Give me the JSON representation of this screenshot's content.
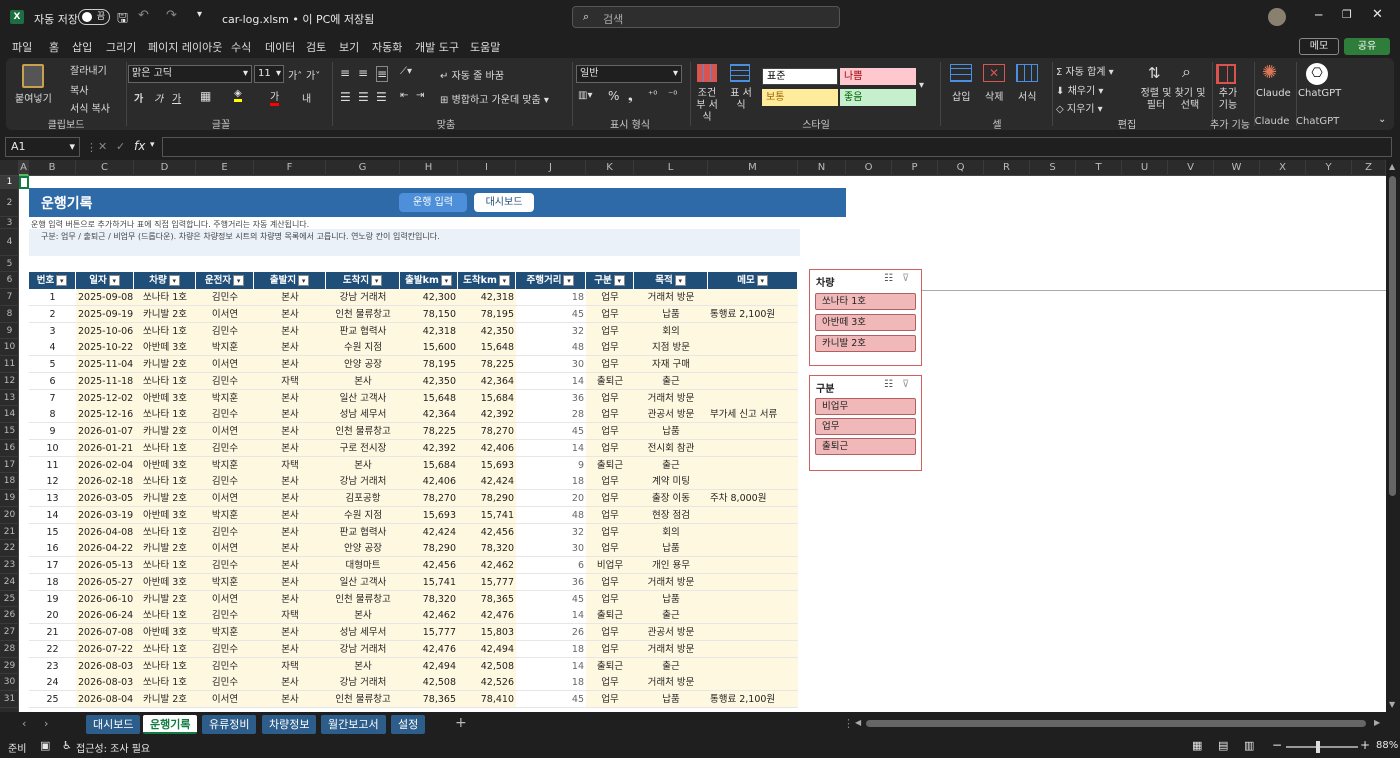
{
  "titlebar": {
    "autosave_label": "자동 저장",
    "toggle_label": "끔",
    "filename": "car-log.xlsm • 이 PC에 저장됨",
    "search_placeholder": "검색"
  },
  "menu": [
    "파일",
    "홈",
    "삽입",
    "그리기",
    "페이지 레이아웃",
    "수식",
    "데이터",
    "검토",
    "보기",
    "자동화",
    "개발 도구",
    "도움말"
  ],
  "menu_right": {
    "memo": "메모",
    "share": "공유"
  },
  "ribbon": {
    "clipboard": {
      "paste": "붙여넣기",
      "cut": "잘라내기",
      "copy": "복사",
      "format_painter": "서식 복사",
      "group": "클립보드"
    },
    "font": {
      "name": "맑은 고딕",
      "size": "11",
      "group": "글꼴"
    },
    "align": {
      "wrap": "자동 줄 바꿈",
      "merge": "병합하고 가운데 맞춤",
      "group": "맞춤"
    },
    "number": {
      "format": "일반",
      "group": "표시 형식"
    },
    "styles": {
      "cond": "조건부 서식",
      "table": "표 서식",
      "normal": "표준",
      "bad": "나쁨",
      "neutral": "보통",
      "good": "좋음",
      "group": "스타일"
    },
    "cells": {
      "insert": "삽입",
      "delete": "삭제",
      "format": "서식",
      "group": "셀"
    },
    "editing": {
      "autosum": "자동 합계",
      "fill": "채우기",
      "clear": "지우기",
      "sort": "정렬 및 필터",
      "find": "찾기 및 선택",
      "group": "편집"
    },
    "addins": {
      "label": "추가 기능",
      "group": "추가 기능"
    },
    "claude": {
      "label": "Claude",
      "group": "Claude"
    },
    "chatgpt": {
      "label": "ChatGPT",
      "group": "ChatGPT"
    }
  },
  "formula_bar": {
    "name_box": "A1",
    "formula": ""
  },
  "columns": [
    "A",
    "B",
    "C",
    "D",
    "E",
    "F",
    "G",
    "H",
    "I",
    "J",
    "K",
    "L",
    "M",
    "N",
    "O",
    "P",
    "Q",
    "R",
    "S",
    "T",
    "U",
    "V",
    "W",
    "X",
    "Y",
    "Z"
  ],
  "sheet": {
    "title": "운행기록",
    "btn_input": "운행 입력",
    "btn_dashboard": "대시보드",
    "note1": "운행 입력 버튼으로 추가하거나 표에 직접 입력합니다. 주행거리는 자동 계산됩니다.",
    "note2": "구분: 업무 / 출퇴근 / 비업무 (드롭다운). 차량은 차량정보 시트의 차량명 목록에서 고릅니다. 연노랑 칸이 입력칸입니다.",
    "headers": [
      "번호",
      "일자",
      "차량",
      "운전자",
      "출발지",
      "도착지",
      "출발km",
      "도착km",
      "주행거리",
      "구분",
      "목적",
      "메모"
    ],
    "rows": [
      [
        "1",
        "2025-09-08",
        "쏘나타 1호",
        "김민수",
        "본사",
        "강남 거래처",
        "42,300",
        "42,318",
        "18",
        "업무",
        "거래처 방문",
        ""
      ],
      [
        "2",
        "2025-09-19",
        "카니발 2호",
        "이서연",
        "본사",
        "인천 물류창고",
        "78,150",
        "78,195",
        "45",
        "업무",
        "납품",
        "통행료 2,100원"
      ],
      [
        "3",
        "2025-10-06",
        "쏘나타 1호",
        "김민수",
        "본사",
        "판교 협력사",
        "42,318",
        "42,350",
        "32",
        "업무",
        "회의",
        ""
      ],
      [
        "4",
        "2025-10-22",
        "아반떼 3호",
        "박지훈",
        "본사",
        "수원 지점",
        "15,600",
        "15,648",
        "48",
        "업무",
        "지점 방문",
        ""
      ],
      [
        "5",
        "2025-11-04",
        "카니발 2호",
        "이서연",
        "본사",
        "안양 공장",
        "78,195",
        "78,225",
        "30",
        "업무",
        "자재 구매",
        ""
      ],
      [
        "6",
        "2025-11-18",
        "쏘나타 1호",
        "김민수",
        "자택",
        "본사",
        "42,350",
        "42,364",
        "14",
        "출퇴근",
        "출근",
        ""
      ],
      [
        "7",
        "2025-12-02",
        "아반떼 3호",
        "박지훈",
        "본사",
        "일산 고객사",
        "15,648",
        "15,684",
        "36",
        "업무",
        "거래처 방문",
        ""
      ],
      [
        "8",
        "2025-12-16",
        "쏘나타 1호",
        "김민수",
        "본사",
        "성남 세무서",
        "42,364",
        "42,392",
        "28",
        "업무",
        "관공서 방문",
        "부가세 신고 서류"
      ],
      [
        "9",
        "2026-01-07",
        "카니발 2호",
        "이서연",
        "본사",
        "인천 물류창고",
        "78,225",
        "78,270",
        "45",
        "업무",
        "납품",
        ""
      ],
      [
        "10",
        "2026-01-21",
        "쏘나타 1호",
        "김민수",
        "본사",
        "구로 전시장",
        "42,392",
        "42,406",
        "14",
        "업무",
        "전시회 참관",
        ""
      ],
      [
        "11",
        "2026-02-04",
        "아반떼 3호",
        "박지훈",
        "자택",
        "본사",
        "15,684",
        "15,693",
        "9",
        "출퇴근",
        "출근",
        ""
      ],
      [
        "12",
        "2026-02-18",
        "쏘나타 1호",
        "김민수",
        "본사",
        "강남 거래처",
        "42,406",
        "42,424",
        "18",
        "업무",
        "계약 미팅",
        ""
      ],
      [
        "13",
        "2026-03-05",
        "카니발 2호",
        "이서연",
        "본사",
        "김포공항",
        "78,270",
        "78,290",
        "20",
        "업무",
        "출장 이동",
        "주차 8,000원"
      ],
      [
        "14",
        "2026-03-19",
        "아반떼 3호",
        "박지훈",
        "본사",
        "수원 지점",
        "15,693",
        "15,741",
        "48",
        "업무",
        "현장 점검",
        ""
      ],
      [
        "15",
        "2026-04-08",
        "쏘나타 1호",
        "김민수",
        "본사",
        "판교 협력사",
        "42,424",
        "42,456",
        "32",
        "업무",
        "회의",
        ""
      ],
      [
        "16",
        "2026-04-22",
        "카니발 2호",
        "이서연",
        "본사",
        "안양 공장",
        "78,290",
        "78,320",
        "30",
        "업무",
        "납품",
        ""
      ],
      [
        "17",
        "2026-05-13",
        "쏘나타 1호",
        "김민수",
        "본사",
        "대형마트",
        "42,456",
        "42,462",
        "6",
        "비업무",
        "개인 용무",
        ""
      ],
      [
        "18",
        "2026-05-27",
        "아반떼 3호",
        "박지훈",
        "본사",
        "일산 고객사",
        "15,741",
        "15,777",
        "36",
        "업무",
        "거래처 방문",
        ""
      ],
      [
        "19",
        "2026-06-10",
        "카니발 2호",
        "이서연",
        "본사",
        "인천 물류창고",
        "78,320",
        "78,365",
        "45",
        "업무",
        "납품",
        ""
      ],
      [
        "20",
        "2026-06-24",
        "쏘나타 1호",
        "김민수",
        "자택",
        "본사",
        "42,462",
        "42,476",
        "14",
        "출퇴근",
        "출근",
        ""
      ],
      [
        "21",
        "2026-07-08",
        "아반떼 3호",
        "박지훈",
        "본사",
        "성남 세무서",
        "15,777",
        "15,803",
        "26",
        "업무",
        "관공서 방문",
        ""
      ],
      [
        "22",
        "2026-07-22",
        "쏘나타 1호",
        "김민수",
        "본사",
        "강남 거래처",
        "42,476",
        "42,494",
        "18",
        "업무",
        "거래처 방문",
        ""
      ],
      [
        "23",
        "2026-08-03",
        "쏘나타 1호",
        "김민수",
        "자택",
        "본사",
        "42,494",
        "42,508",
        "14",
        "출퇴근",
        "출근",
        ""
      ],
      [
        "24",
        "2026-08-03",
        "쏘나타 1호",
        "김민수",
        "본사",
        "강남 거래처",
        "42,508",
        "42,526",
        "18",
        "업무",
        "거래처 방문",
        ""
      ],
      [
        "25",
        "2026-08-04",
        "카니발 2호",
        "이서연",
        "본사",
        "인천 물류창고",
        "78,365",
        "78,410",
        "45",
        "업무",
        "납품",
        "통행료 2,100원"
      ]
    ]
  },
  "slicer_car": {
    "title": "차량",
    "items": [
      "쏘나타 1호",
      "아반떼 3호",
      "카니발 2호"
    ]
  },
  "slicer_type": {
    "title": "구분",
    "items": [
      "비업무",
      "업무",
      "출퇴근"
    ]
  },
  "tabs": [
    "대시보드",
    "운행기록",
    "유류정비",
    "차량정보",
    "월간보고서",
    "설정"
  ],
  "active_tab": "운행기록",
  "status": {
    "ready": "준비",
    "accessibility": "접근성: 조사 필요",
    "zoom": "88%"
  }
}
